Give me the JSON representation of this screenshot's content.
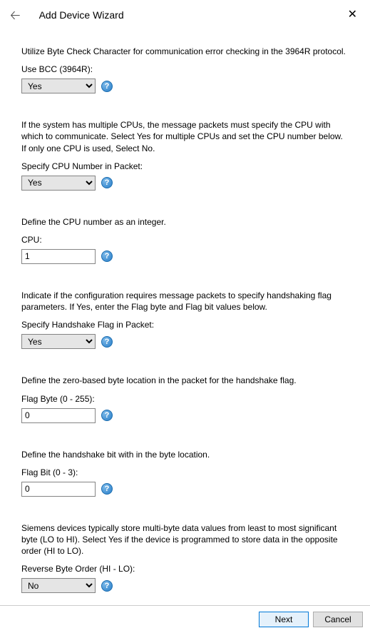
{
  "header": {
    "title": "Add Device Wizard"
  },
  "sections": {
    "bcc": {
      "desc": "Utilize Byte Check Character for communication error checking in the 3964R protocol.",
      "label": "Use BCC (3964R):",
      "value": "Yes"
    },
    "cpuSpecify": {
      "desc": "If the system has multiple CPUs, the message packets must specify the CPU with which to communicate. Select Yes for multiple CPUs and set the CPU number below. If only one CPU is used, Select No.",
      "label": "Specify CPU Number in Packet:",
      "value": "Yes"
    },
    "cpuNum": {
      "desc": "Define the CPU number as an integer.",
      "label": "CPU:",
      "value": "1"
    },
    "handshake": {
      "desc": "Indicate if the configuration requires message packets to specify handshaking flag parameters. If Yes, enter the Flag byte and Flag bit values below.",
      "label": "Specify Handshake Flag in Packet:",
      "value": "Yes"
    },
    "flagByte": {
      "desc": "Define the zero-based byte location in the packet for the handshake flag.",
      "label": "Flag Byte (0 - 255):",
      "value": "0"
    },
    "flagBit": {
      "desc": "Define the handshake bit with in the byte location.",
      "label": "Flag Bit (0 - 3):",
      "value": "0"
    },
    "reverseByte": {
      "desc": "Siemens devices typically store multi-byte data values from least to most significant byte (LO to HI). Select Yes if the device is programmed to store data in the opposite order (HI to LO).",
      "label": "Reverse Byte Order (HI - LO):",
      "value": "No"
    }
  },
  "options": {
    "yesNo": [
      "Yes",
      "No"
    ]
  },
  "footer": {
    "next": "Next",
    "cancel": "Cancel"
  },
  "help": "?"
}
